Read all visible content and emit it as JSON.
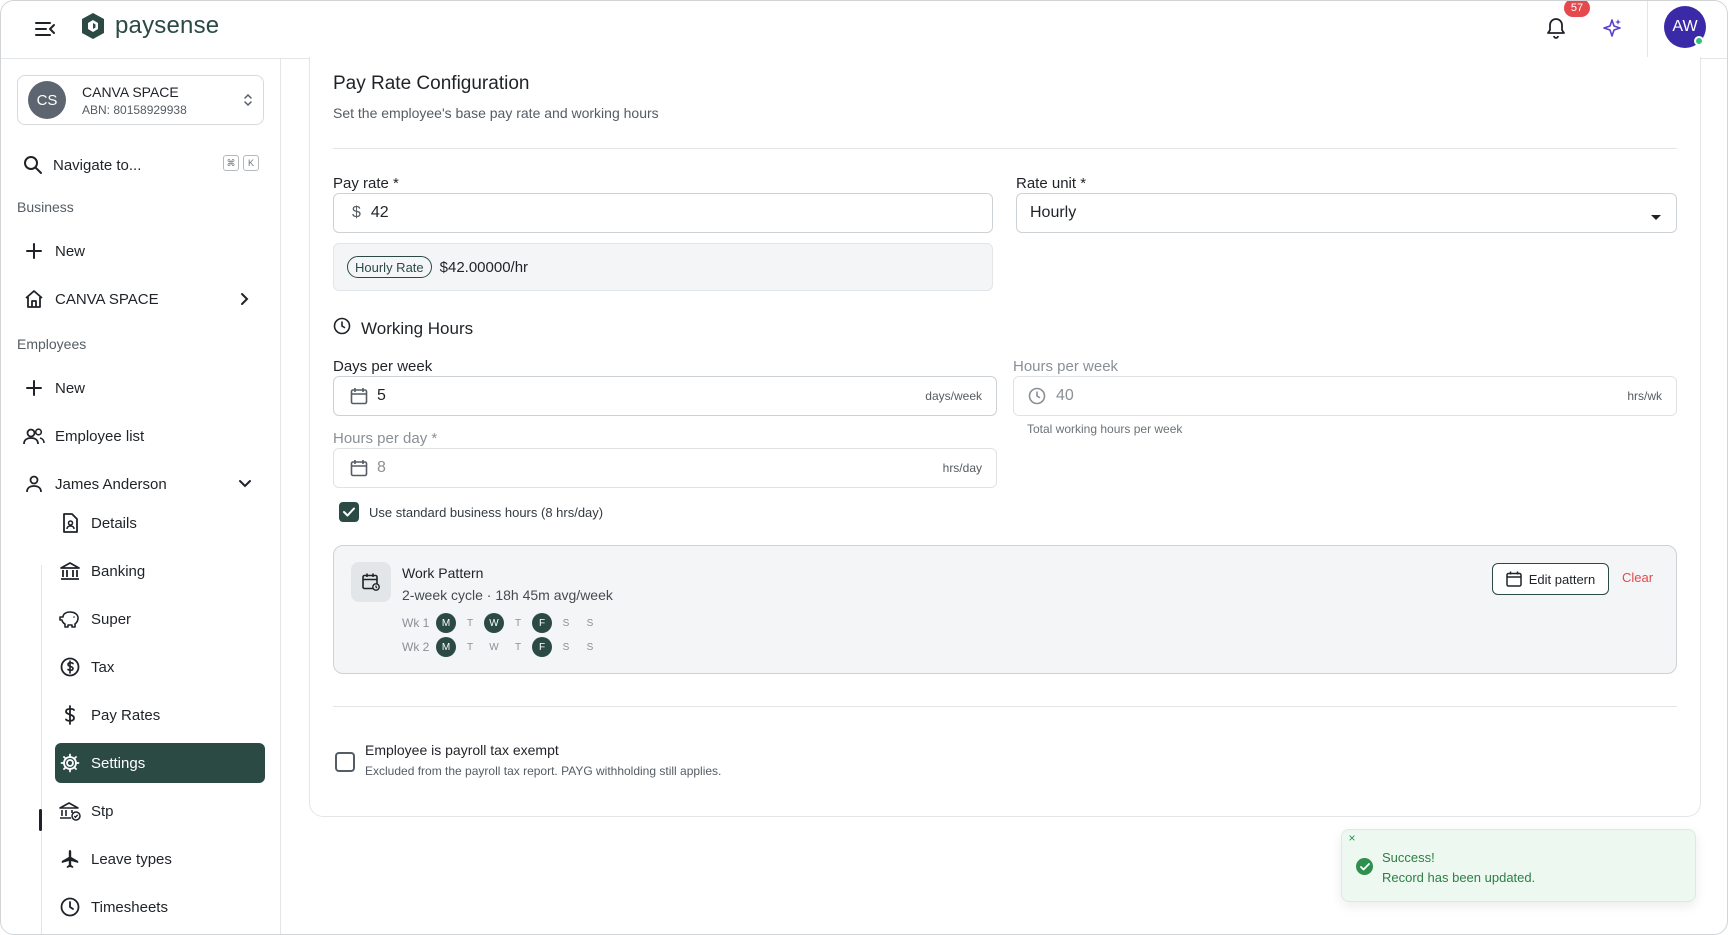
{
  "header": {
    "brand": "paysense",
    "notification_count": "57",
    "user_initials": "AW"
  },
  "sidebar": {
    "org": {
      "initials": "CS",
      "name": "CANVA SPACE",
      "abn": "ABN: 80158929938"
    },
    "navigate": {
      "label": "Navigate to...",
      "kbd_cmd": "⌘",
      "kbd_key": "K"
    },
    "business_label": "Business",
    "business_items": [
      {
        "label": "New",
        "icon": "plus-icon"
      },
      {
        "label": "CANVA SPACE",
        "icon": "home-icon"
      }
    ],
    "employees_label": "Employees",
    "employee_items": [
      {
        "label": "New",
        "icon": "plus-icon"
      },
      {
        "label": "Employee list",
        "icon": "people-icon"
      },
      {
        "label": "James Anderson",
        "icon": "person-icon"
      }
    ],
    "sub_items": [
      {
        "label": "Details",
        "icon": "document-icon"
      },
      {
        "label": "Banking",
        "icon": "bank-icon"
      },
      {
        "label": "Super",
        "icon": "piggy-bank-icon"
      },
      {
        "label": "Tax",
        "icon": "dollar-circle-icon"
      },
      {
        "label": "Pay Rates",
        "icon": "dollar-icon"
      },
      {
        "label": "Settings",
        "icon": "gear-icon",
        "active": true
      },
      {
        "label": "Stp",
        "icon": "bank-check-icon"
      },
      {
        "label": "Leave types",
        "icon": "plane-icon"
      },
      {
        "label": "Timesheets",
        "icon": "clock-icon"
      }
    ]
  },
  "main": {
    "title": "Pay Rate Configuration",
    "subtitle": "Set the employee's base pay rate and working hours",
    "pay_rate": {
      "label": "Pay rate",
      "required": "*",
      "currency": "$",
      "value": "42"
    },
    "rate_unit": {
      "label": "Rate unit",
      "required": "*",
      "value": "Hourly"
    },
    "rate_summary": {
      "chip": "Hourly Rate",
      "value": "$42.00000/hr"
    },
    "working_hours": {
      "title": "Working Hours",
      "days_per_week": {
        "label": "Days per week",
        "value": "5",
        "suffix": "days/week"
      },
      "hours_per_week": {
        "label": "Hours per week",
        "value": "40",
        "suffix": "hrs/wk",
        "helper": "Total working hours per week"
      },
      "hours_per_day": {
        "label": "Hours per day",
        "required": "*",
        "value": "8",
        "suffix": "hrs/day"
      },
      "standard_hours": {
        "label": "Use standard business hours (8 hrs/day)",
        "checked": true
      }
    },
    "work_pattern": {
      "title": "Work Pattern",
      "summary": "2-week cycle · 18h 45m avg/week",
      "weeks": [
        {
          "label": "Wk 1",
          "days": [
            {
              "d": "M",
              "on": true
            },
            {
              "d": "T",
              "on": false
            },
            {
              "d": "W",
              "on": true
            },
            {
              "d": "T",
              "on": false
            },
            {
              "d": "F",
              "on": true
            },
            {
              "d": "S",
              "on": false
            },
            {
              "d": "S",
              "on": false
            }
          ]
        },
        {
          "label": "Wk 2",
          "days": [
            {
              "d": "M",
              "on": true
            },
            {
              "d": "T",
              "on": false
            },
            {
              "d": "W",
              "on": false
            },
            {
              "d": "T",
              "on": false
            },
            {
              "d": "F",
              "on": true
            },
            {
              "d": "S",
              "on": false
            },
            {
              "d": "S",
              "on": false
            }
          ]
        }
      ],
      "edit_label": "Edit pattern",
      "clear_label": "Clear"
    },
    "tax_exempt": {
      "label": "Employee is payroll tax exempt",
      "description": "Excluded from the payroll tax report. PAYG withholding still applies.",
      "checked": false
    }
  },
  "toast": {
    "title": "Success!",
    "message": "Record has been updated.",
    "close": "×"
  },
  "colors": {
    "brand": "#2c4a44",
    "accent_purple": "#3b2aa8",
    "danger": "#e5484d",
    "success": "#2f8f4f"
  }
}
